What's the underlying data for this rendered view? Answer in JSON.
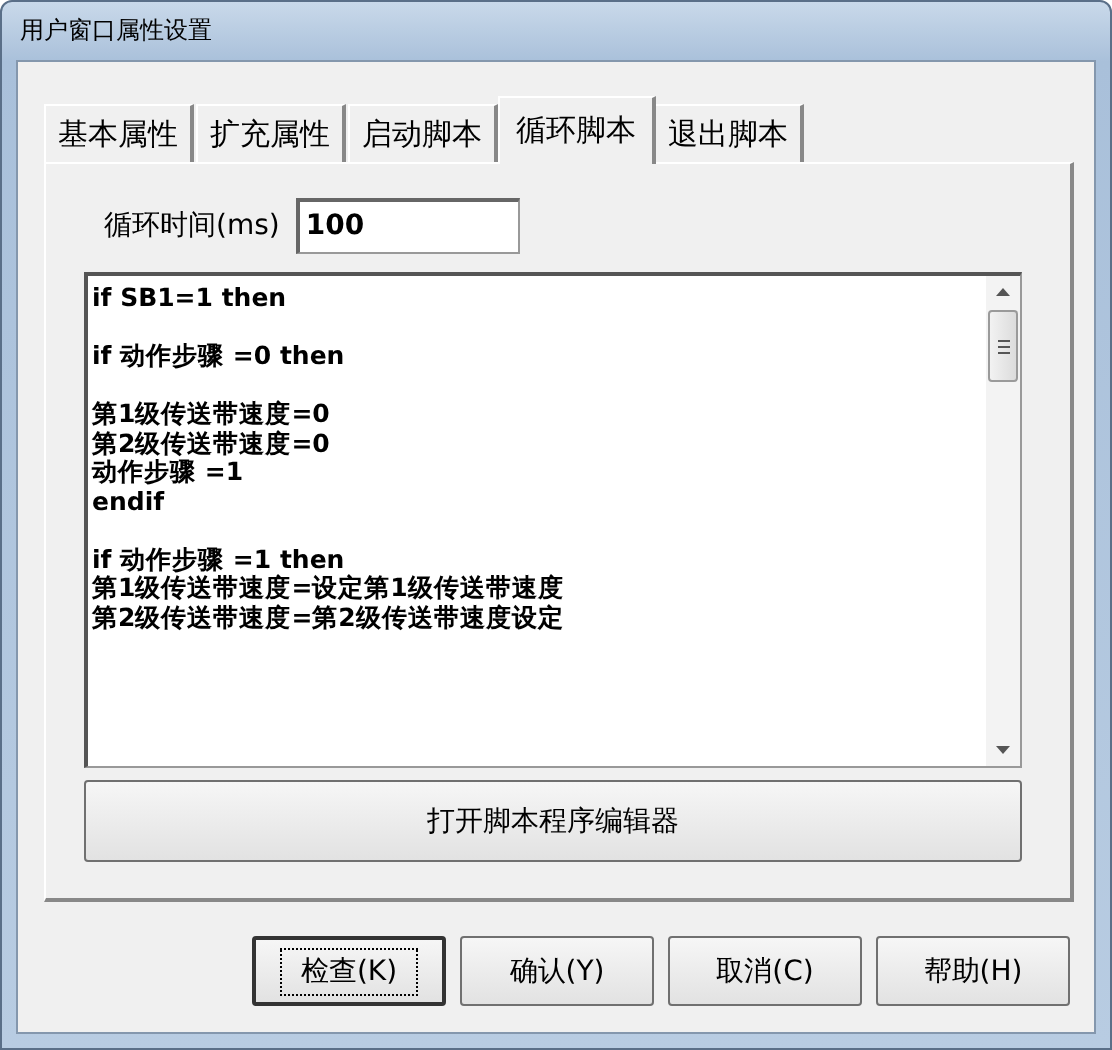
{
  "window": {
    "title": "用户窗口属性设置"
  },
  "tabs": [
    {
      "label": "基本属性",
      "selected": false
    },
    {
      "label": "扩充属性",
      "selected": false
    },
    {
      "label": "启动脚本",
      "selected": false
    },
    {
      "label": "循环脚本",
      "selected": true
    },
    {
      "label": "退出脚本",
      "selected": false
    }
  ],
  "cycle_time": {
    "label": "循环时间(ms)",
    "value": "100"
  },
  "script_blocks": [
    [
      "if SB1=1 then"
    ],
    [
      "if 动作步骤 =0 then"
    ],
    [
      "第1级传送带速度=0",
      "第2级传送带速度=0",
      "动作步骤 =1",
      "endif"
    ],
    [
      "if 动作步骤 =1 then",
      "第1级传送带速度=设定第1级传送带速度",
      "第2级传送带速度=第2级传送带速度设定"
    ]
  ],
  "editor_button": "打开脚本程序编辑器",
  "buttons": [
    {
      "label": "检查(K)",
      "focused": true
    },
    {
      "label": "确认(Y)",
      "focused": false
    },
    {
      "label": "取消(C)",
      "focused": false
    },
    {
      "label": "帮助(H)",
      "focused": false
    }
  ]
}
